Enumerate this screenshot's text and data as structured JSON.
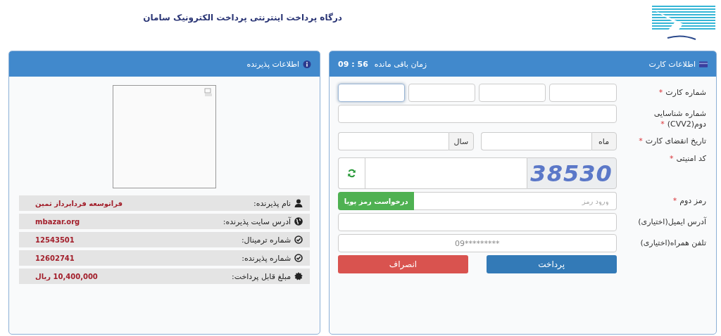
{
  "header": {
    "title": "درگاه پرداخت اینترنتی پرداخت الکترونیک سامان"
  },
  "card_panel": {
    "title": "اطلاعات کارت",
    "required_mark": "*",
    "timer_label": "زمان باقی مانده",
    "timer_value": "56 : 09",
    "fields": [
      {
        "kind": "card_number",
        "label": "شماره کارت",
        "required": true,
        "segments": [
          {
            "focused": true
          },
          {
            "focused": false
          },
          {
            "focused": false
          },
          {
            "focused": false
          }
        ]
      },
      {
        "kind": "text",
        "label": "شماره شناسایی دوم(CVV2)",
        "required": true
      },
      {
        "kind": "expiry",
        "label": "تاریخ انقضای کارت",
        "required": true,
        "month_addon": "ماه",
        "year_addon": "سال"
      },
      {
        "kind": "captcha",
        "label": "کد امنیتی",
        "required": true,
        "code": "38530"
      },
      {
        "kind": "password",
        "label": "رمز دوم",
        "required": true,
        "placeholder": "ورود رمز",
        "button": "درخواست رمز پویا"
      },
      {
        "kind": "text",
        "label": "آدرس ایمیل(اختیاری)",
        "required": false
      },
      {
        "kind": "text",
        "label": "تلفن همراه(اختیاری)",
        "required": false,
        "placeholder": "09*********"
      }
    ],
    "buttons": [
      {
        "kind": "primary",
        "label": "پرداخت"
      },
      {
        "kind": "danger",
        "label": "انصراف"
      }
    ]
  },
  "merchant_panel": {
    "title": "اطلاعات پذیرنده",
    "rows": [
      {
        "kind": "person",
        "label": "نام پذیرنده:",
        "value": "فراتوسعه فرداپرداز ثمین"
      },
      {
        "kind": "globe",
        "label": "آدرس سایت پذیرنده:",
        "value": "mbazar.org"
      },
      {
        "kind": "check",
        "label": "شماره ترمینال:",
        "value": "12543501"
      },
      {
        "kind": "check",
        "label": "شماره پذیرنده:",
        "value": "12602741"
      },
      {
        "kind": "seal",
        "label": "مبلغ قابل پرداخت:",
        "value": "10,400,000 ریال"
      }
    ]
  }
}
